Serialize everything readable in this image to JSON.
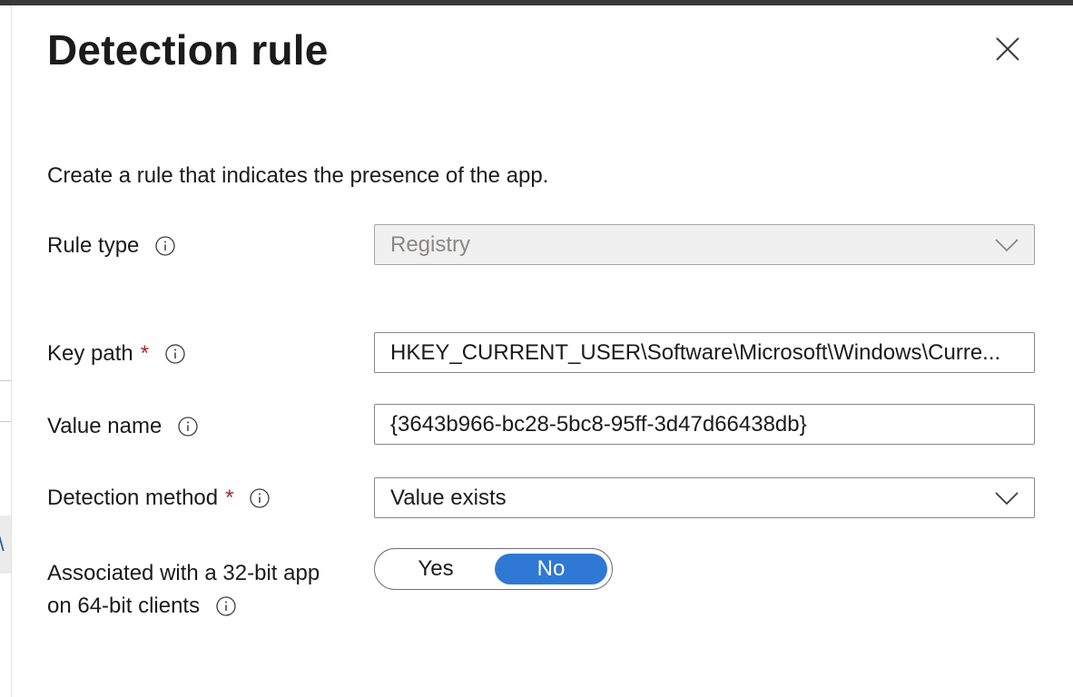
{
  "panel": {
    "title": "Detection rule",
    "description": "Create a rule that indicates the presence of the app."
  },
  "form": {
    "rule_type": {
      "label": "Rule type",
      "value": "Registry",
      "disabled": true
    },
    "key_path": {
      "label": "Key path",
      "required_mark": "*",
      "value": "HKEY_CURRENT_USER\\Software\\Microsoft\\Windows\\CurrentVersion\\Uninstall",
      "display_value": "HKEY_CURRENT_USER\\Software\\Microsoft\\Windows\\Curre..."
    },
    "value_name": {
      "label": "Value name",
      "value": "{3643b966-bc28-5bc8-95ff-3d47d66438db}"
    },
    "detection_method": {
      "label": "Detection method",
      "required_mark": "*",
      "value": "Value exists"
    },
    "associated_32bit": {
      "label_line1": "Associated with a 32-bit app",
      "label_line2": "on 64-bit clients",
      "options": [
        "Yes",
        "No"
      ],
      "selected": "No"
    }
  },
  "icons": {
    "close": "close-icon",
    "info": "info-icon",
    "chevron": "chevron-down-icon"
  },
  "colors": {
    "accent": "#2f78d4",
    "required": "#a4262c",
    "border": "#8a8886",
    "disabled_bg": "#f0f0f0"
  }
}
